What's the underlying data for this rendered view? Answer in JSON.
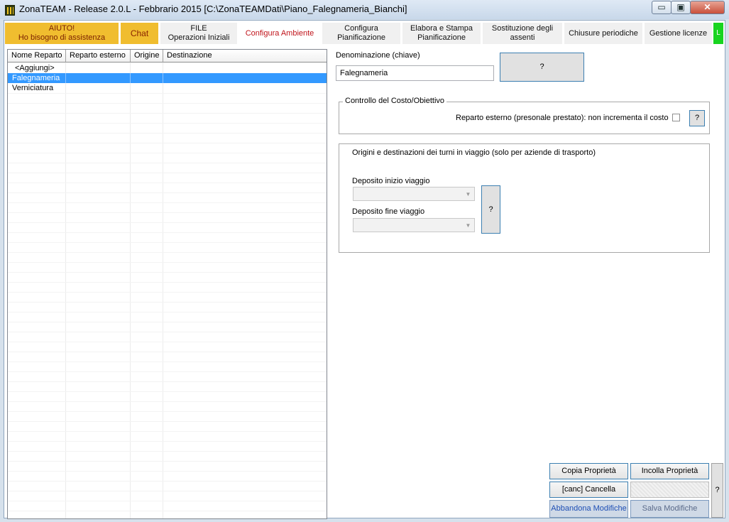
{
  "window": {
    "title": "ZonaTEAM - Release 2.0.L - Febbrario 2015 [C:\\ZonaTEAMDati\\Piano_Falegnameria_Bianchi]",
    "minimize": "▭",
    "maximize": "▣",
    "close": "✕"
  },
  "tabs": [
    {
      "line1": "AIUTO!",
      "line2": "Ho bisogno di assistenza"
    },
    {
      "line1": "Chat",
      "line2": ""
    },
    {
      "line1": "FILE",
      "line2": "Operazioni Iniziali"
    },
    {
      "line1": "Configura Ambiente",
      "line2": ""
    },
    {
      "line1": "Configura",
      "line2": "Pianificazione"
    },
    {
      "line1": "Elabora e Stampa",
      "line2": "Pianificazione"
    },
    {
      "line1": "Sostituzione degli",
      "line2": "assenti"
    },
    {
      "line1": "Chiusure periodiche",
      "line2": ""
    },
    {
      "line1": "Gestione licenze",
      "line2": ""
    }
  ],
  "tab_indicator": "L",
  "grid": {
    "columns": [
      "Nome Reparto",
      "Reparto esterno",
      "Origine",
      "Destinazione"
    ],
    "rows": [
      {
        "name": "<Aggiungi>",
        "selected": false
      },
      {
        "name": "Falegnameria",
        "selected": true
      },
      {
        "name": "Verniciatura",
        "selected": false
      }
    ]
  },
  "form": {
    "denominazione_label": "Denominazione (chiave)",
    "denominazione_value": "Falegnameria",
    "help_label": "?",
    "costo_group_title": "Controllo del Costo/Obiettivo",
    "reparto_esterno_label": "Reparto esterno (presonale prestato): non incrementa il costo",
    "reparto_esterno_checked": false,
    "viaggio_group_title": "Origini e destinazioni dei turni in viaggio (solo per aziende di trasporto)",
    "deposito_inizio_label": "Deposito inizio viaggio",
    "deposito_fine_label": "Deposito fine viaggio"
  },
  "buttons": {
    "copia": "Copia Proprietà",
    "incolla": "Incolla Proprietà",
    "cancella": "[canc] Cancella",
    "abbandona": "Abbandona Modifiche",
    "salva": "Salva Modifiche",
    "help": "?"
  }
}
